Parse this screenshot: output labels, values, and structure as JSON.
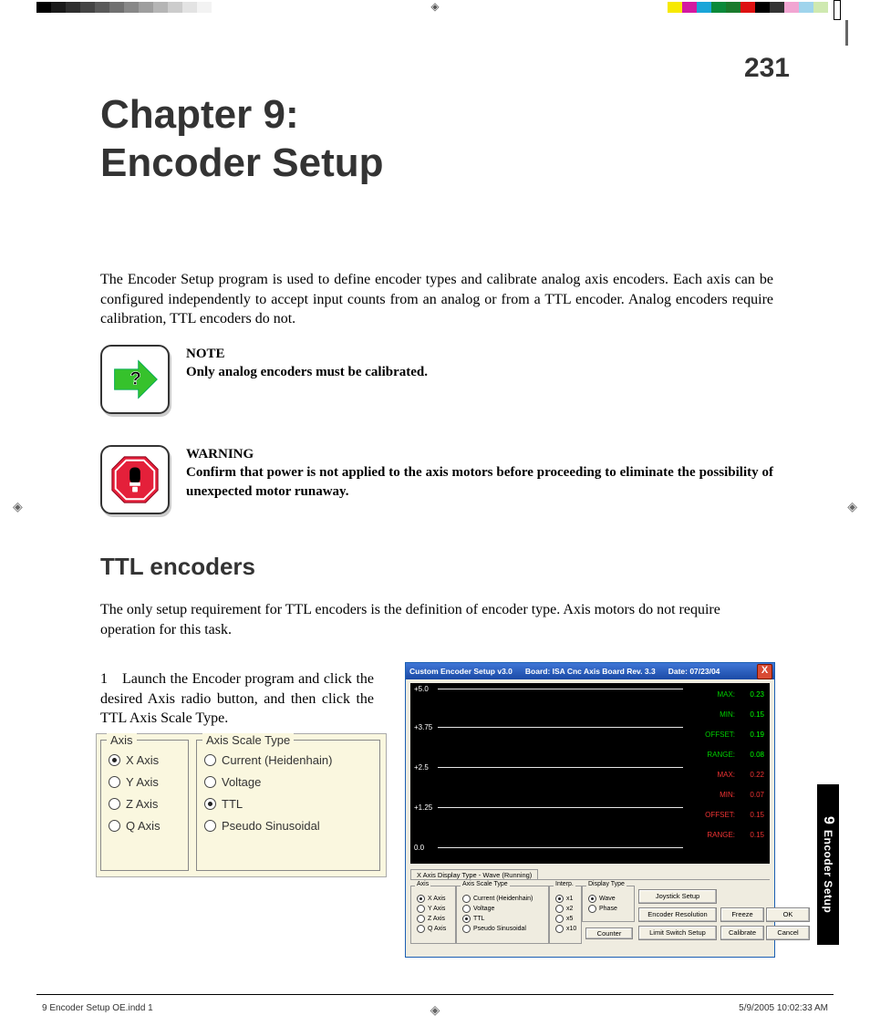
{
  "page_number": "231",
  "chapter_title_line1": "Chapter 9:",
  "chapter_title_line2": "Encoder Setup",
  "intro": "The Encoder Setup program is used to define encoder types and calibrate analog axis encoders. Each axis can be configured independently to accept input counts from an analog or from a TTL encoder.  Analog encoders require calibration, TTL encoders do not.",
  "note": {
    "label": "NOTE",
    "body": "Only analog encoders must be calibrated."
  },
  "warning": {
    "label": "WARNING",
    "body": "Confirm that power is not applied to the axis motors before proceeding to eliminate the possibility of unexpected motor runaway."
  },
  "section_title": "TTL encoders",
  "section_intro": "The only setup requirement for TTL encoders is the definition of encoder type.  Axis motors do not require operation for this task.",
  "step1": "1 Launch the Encoder program and click the desired Axis radio button, and then click the TTL Axis Scale Type.",
  "axis_group": {
    "title": "Axis",
    "options": [
      "X Axis",
      "Y Axis",
      "Z Axis",
      "Q Axis"
    ],
    "selected": 0
  },
  "scale_group": {
    "title": "Axis Scale Type",
    "options": [
      "Current (Heidenhain)",
      "Voltage",
      "TTL",
      "Pseudo Sinusoidal"
    ],
    "selected": 2
  },
  "app": {
    "title_left": "Custom Encoder Setup v3.0",
    "title_mid": "Board: ISA Cnc Axis Board Rev. 3.3",
    "title_right": "Date: 07/23/04",
    "close": "X",
    "yt": [
      "+5.0",
      "+3.75",
      "+2.5",
      "+1.25",
      "0.0"
    ],
    "readouts": [
      {
        "k": "MAX:",
        "v": "0.23",
        "red": false
      },
      {
        "k": "MIN:",
        "v": "0.15",
        "red": false
      },
      {
        "k": "OFFSET:",
        "v": "0.19",
        "red": false
      },
      {
        "k": "RANGE:",
        "v": "0.08",
        "red": false
      },
      {
        "k": "MAX:",
        "v": "0.22",
        "red": true
      },
      {
        "k": "MIN:",
        "v": "0.07",
        "red": true
      },
      {
        "k": "OFFSET:",
        "v": "0.15",
        "red": true
      },
      {
        "k": "RANGE:",
        "v": "0.15",
        "red": true
      }
    ],
    "tab": "X Axis  Display Type - Wave (Running)",
    "axis": {
      "title": "Axis",
      "opts": [
        "X Axis",
        "Y Axis",
        "Z Axis",
        "Q Axis"
      ],
      "sel": 0
    },
    "scale": {
      "title": "Axis Scale Type",
      "opts": [
        "Current (Heidenhain)",
        "Voltage",
        "TTL",
        "Pseudo Sinusoidal"
      ],
      "sel": 2
    },
    "interp": {
      "title": "Interp.",
      "opts": [
        "x1",
        "x2",
        "x5",
        "x10"
      ],
      "sel": 0
    },
    "disp": {
      "title": "Display Type",
      "opts": [
        "Wave",
        "Phase"
      ],
      "sel": 0
    },
    "buttons": {
      "joystick": "Joystick Setup",
      "encres": "Encoder Resolution",
      "limit": "Limit Switch Setup",
      "counter": "Counter",
      "freeze": "Freeze",
      "calibrate": "Calibrate",
      "ok": "OK",
      "cancel": "Cancel"
    }
  },
  "thumb": {
    "num": "9",
    "label": "Encoder Setup"
  },
  "footer": {
    "left": "9 Encoder Setup OE.indd   1",
    "right": "5/9/2005   10:02:33 AM"
  },
  "greys": [
    "#000",
    "#1a1a1a",
    "#2e2e2e",
    "#444",
    "#5a5a5a",
    "#707070",
    "#888",
    "#9e9e9e",
    "#b5b5b5",
    "#ccc",
    "#e3e3e3",
    "#f3f3f3",
    "#fff",
    "#fff",
    "#fff",
    "#fff"
  ],
  "colors": [
    "#f7e900",
    "#d419a0",
    "#1aa5d8",
    "#0a8a3a",
    "#1a7a2c",
    "#d11",
    "#000",
    "#333",
    "#f1a5d2",
    "#9fd4ec",
    "#cfe9b0"
  ]
}
